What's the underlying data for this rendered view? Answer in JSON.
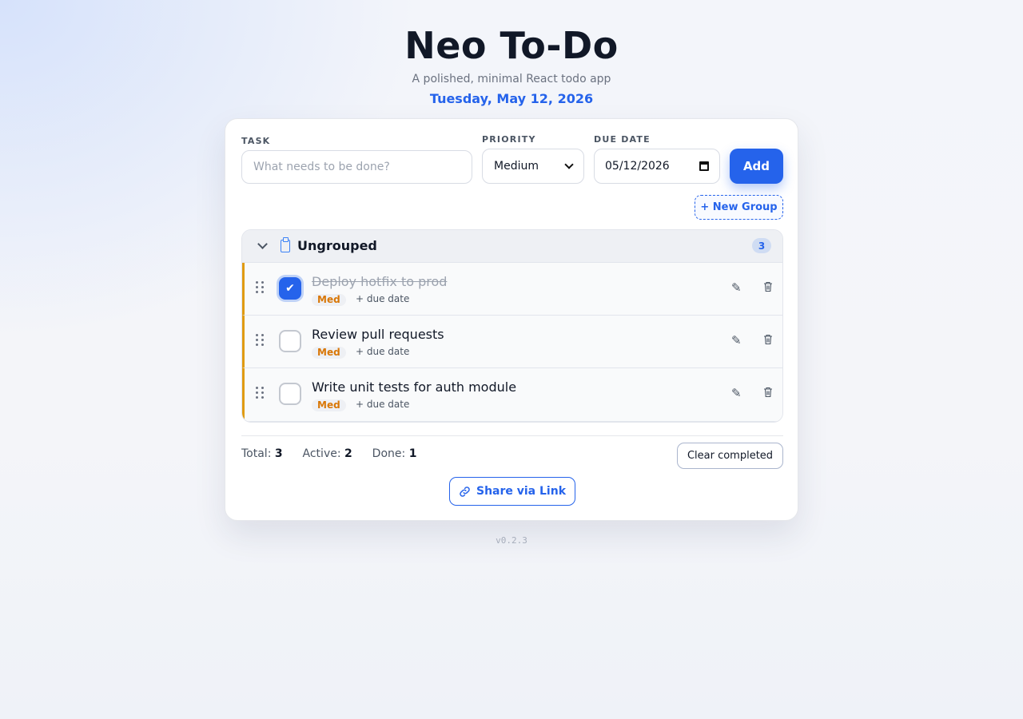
{
  "app": {
    "title": "Neo To-Do",
    "subtitle": "A polished, minimal React todo app",
    "date": "Tuesday, May 12, 2026",
    "version": "v0.2.3"
  },
  "form": {
    "task_label": "TASK",
    "task_placeholder": "What needs to be done?",
    "task_value": "",
    "priority_label": "PRIORITY",
    "priority_value": "Medium",
    "due_label": "DUE DATE",
    "due_value": "05/12/2026",
    "add_label": "Add"
  },
  "new_group_label": "+ New Group",
  "group": {
    "title": "Ungrouped",
    "count": "3",
    "icon": "clipboard-icon",
    "todos": [
      {
        "title": "Deploy hotfix to prod",
        "done": true,
        "priority": "Med",
        "due": "+ due date",
        "check": "✔"
      },
      {
        "title": "Review pull requests",
        "done": false,
        "priority": "Med",
        "due": "+ due date",
        "check": ""
      },
      {
        "title": "Write unit tests for auth module",
        "done": false,
        "priority": "Med",
        "due": "+ due date",
        "check": ""
      }
    ]
  },
  "stats": {
    "total_label": "Total:",
    "total": "3",
    "active_label": "Active:",
    "active": "2",
    "done_label": "Done:",
    "done": "1"
  },
  "clear_completed_label": "Clear completed",
  "share_label": "Share via Link",
  "colors": {
    "accent": "#2563eb",
    "priority_medium": "#d97706",
    "row_border": "#e09b12"
  }
}
